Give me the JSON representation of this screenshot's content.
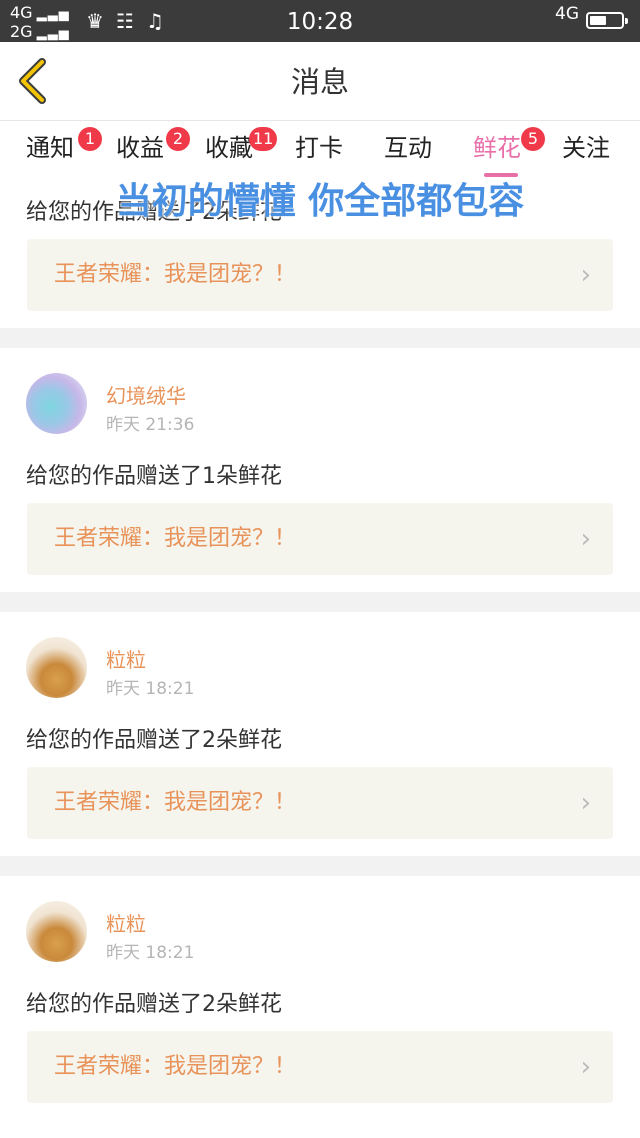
{
  "status_bar": {
    "signal1": "4G",
    "signal2": "2G",
    "time": "10:28",
    "network": "4G"
  },
  "header": {
    "title": "消息"
  },
  "tabs": [
    {
      "label": "通知",
      "badge": "1"
    },
    {
      "label": "收益",
      "badge": "2"
    },
    {
      "label": "收藏",
      "badge": "11"
    },
    {
      "label": "打卡",
      "badge": ""
    },
    {
      "label": "互动",
      "badge": ""
    },
    {
      "label": "鲜花",
      "badge": "5"
    },
    {
      "label": "关注",
      "badge": ""
    }
  ],
  "overlay_text": "当初的懵懂 你全部都包容",
  "feed": [
    {
      "message": "给您的作品赠送了2朵鲜花",
      "ref": "王者荣耀：我是团宠？！"
    },
    {
      "user": "幻境绒华",
      "time": "昨天 21:36",
      "message": "给您的作品赠送了1朵鲜花",
      "ref": "王者荣耀：我是团宠？！"
    },
    {
      "user": "粒粒",
      "time": "昨天 18:21",
      "message": "给您的作品赠送了2朵鲜花",
      "ref": "王者荣耀：我是团宠？！"
    },
    {
      "user": "粒粒",
      "time": "昨天 18:21",
      "message": "给您的作品赠送了2朵鲜花",
      "ref": "王者荣耀：我是团宠？！"
    }
  ],
  "colors": {
    "accent": "#e96fa8",
    "badge": "#f03a4a",
    "username": "#e8935a"
  }
}
